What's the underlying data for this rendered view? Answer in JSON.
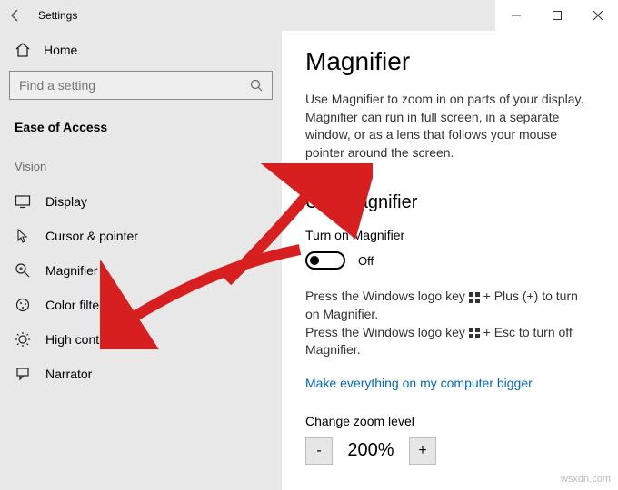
{
  "titlebar": {
    "title": "Settings"
  },
  "sidebar": {
    "home": "Home",
    "search_placeholder": "Find a setting",
    "group": "Ease of Access",
    "subgroup": "Vision",
    "items": [
      {
        "label": "Display"
      },
      {
        "label": "Cursor & pointer"
      },
      {
        "label": "Magnifier"
      },
      {
        "label": "Color filters"
      },
      {
        "label": "High contrast"
      },
      {
        "label": "Narrator"
      }
    ]
  },
  "main": {
    "title": "Magnifier",
    "description": "Use Magnifier to zoom in on parts of your display. Magnifier can run in full screen, in a separate window, or as a lens that follows your mouse pointer around the screen.",
    "use_heading": "Use Magnifier",
    "turn_on_label": "Turn on Magnifier",
    "toggle_state": "Off",
    "hint_on_a": "Press the Windows logo key ",
    "hint_on_b": " + Plus (+) to turn on Magnifier.",
    "hint_off_a": "Press the Windows logo key ",
    "hint_off_b": " + Esc to turn off Magnifier.",
    "link": "Make everything on my computer bigger",
    "zoom_label": "Change zoom level",
    "zoom_value": "200%",
    "zoom_minus": "-",
    "zoom_plus": "+"
  },
  "watermark": "wsxdn.com"
}
